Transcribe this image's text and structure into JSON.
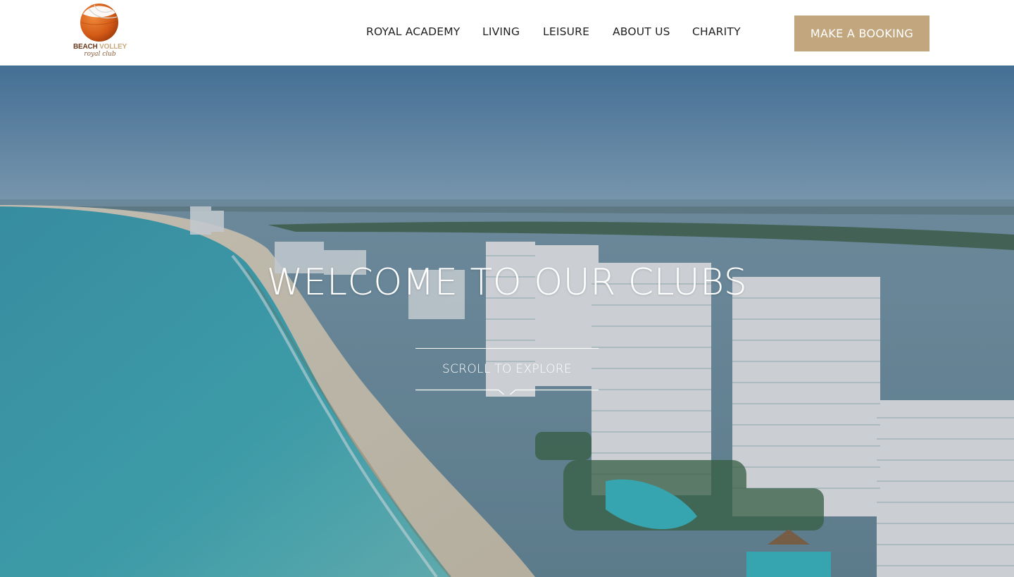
{
  "logo": {
    "brand_word_1": "BEACH",
    "brand_word_2": "VOLLEY",
    "tagline": "royal club"
  },
  "nav": {
    "items": [
      {
        "label": "ROYAL ACADEMY"
      },
      {
        "label": "LIVING"
      },
      {
        "label": "LEISURE"
      },
      {
        "label": "ABOUT US"
      },
      {
        "label": "CHARITY"
      }
    ]
  },
  "cta": {
    "booking_label": "MAKE A BOOKING"
  },
  "hero": {
    "title": "WELCOME TO OUR CLUBS",
    "scroll_label": "SCROLL TO EXPLORE"
  },
  "colors": {
    "accent": "#c2a67e",
    "header_bg": "#ffffff",
    "nav_text": "#1f1f1f",
    "hero_text": "#ffffff",
    "ball_orange": "#d9641e"
  }
}
